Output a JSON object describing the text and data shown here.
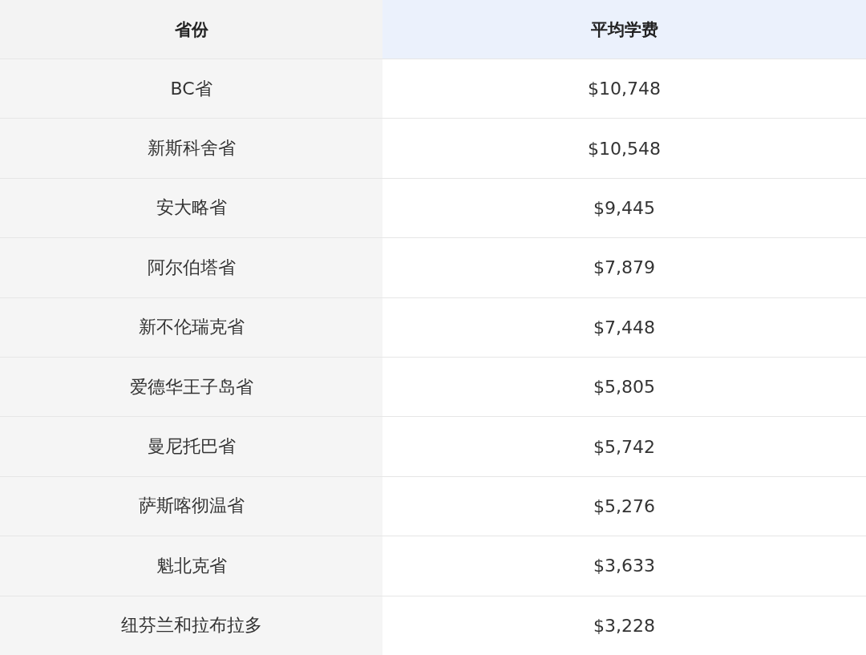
{
  "table": {
    "columns": [
      "省份",
      "平均学费"
    ],
    "rows": [
      [
        "BC省",
        "$10,748"
      ],
      [
        "新斯科舍省",
        "$10,548"
      ],
      [
        "安大略省",
        "$9,445"
      ],
      [
        "阿尔伯塔省",
        "$7,879"
      ],
      [
        "新不伦瑞克省",
        "$7,448"
      ],
      [
        "爱德华王子岛省",
        "$5,805"
      ],
      [
        "曼尼托巴省",
        "$5,742"
      ],
      [
        "萨斯喀彻温省",
        "$5,276"
      ],
      [
        "魁北克省",
        "$3,633"
      ],
      [
        "纽芬兰和拉布拉多",
        "$3,228"
      ]
    ]
  }
}
